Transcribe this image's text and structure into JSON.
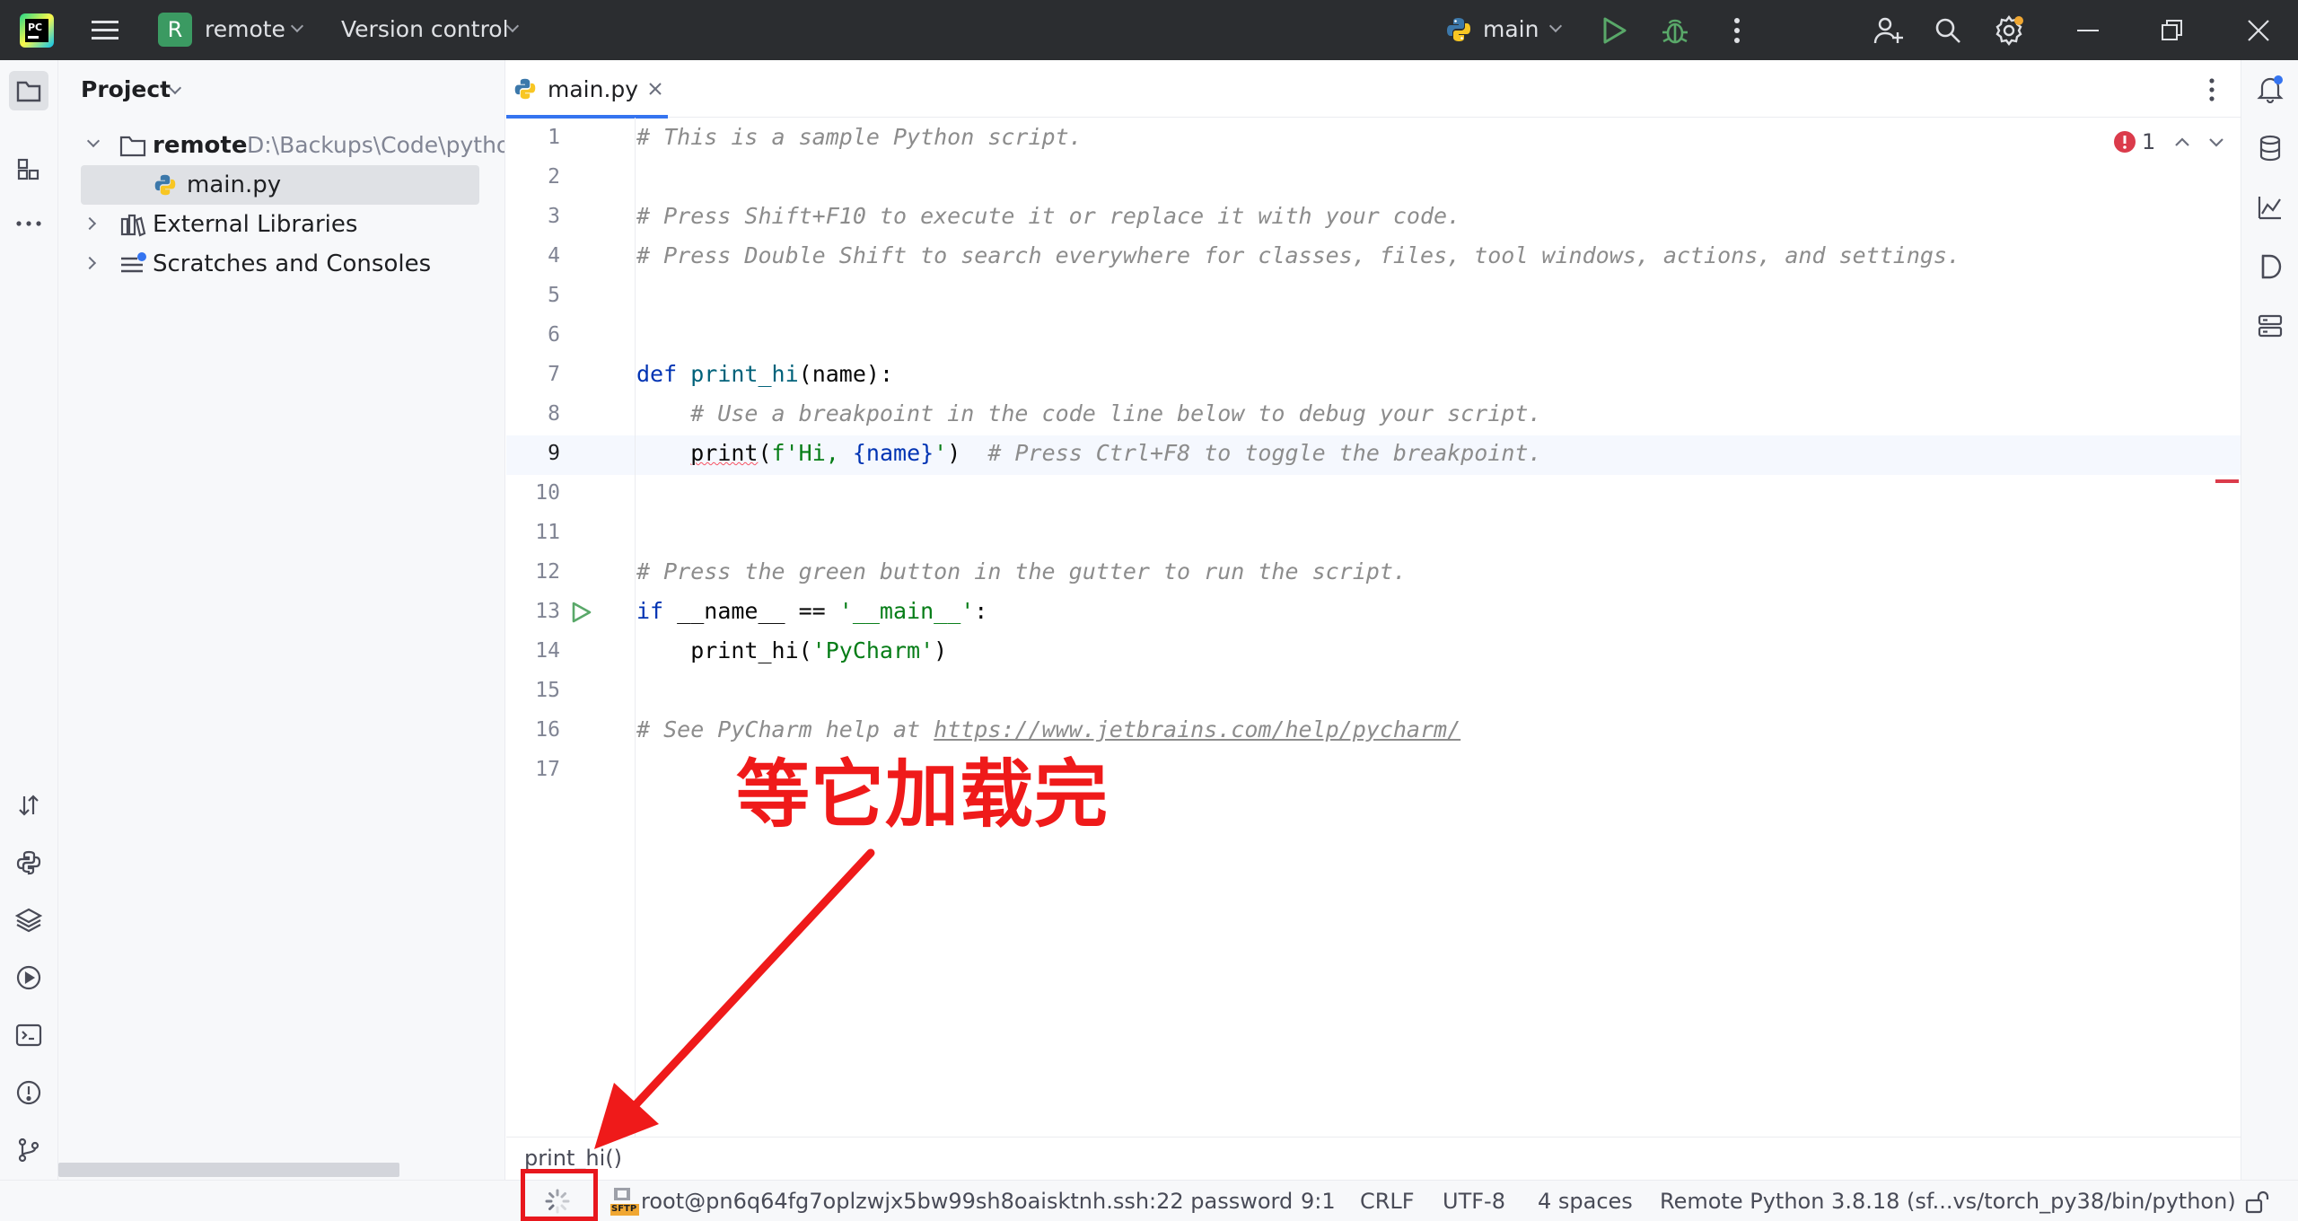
{
  "titlebar": {
    "project_badge": "R",
    "project_name": "remote",
    "vcs_label": "Version control",
    "run_config": "main"
  },
  "project_panel": {
    "title": "Project",
    "tree": [
      {
        "label": "remote",
        "path": "D:\\Backups\\Code\\pytho"
      },
      {
        "label": "main.py"
      },
      {
        "label": "External Libraries"
      },
      {
        "label": "Scratches and Consoles"
      }
    ]
  },
  "editor": {
    "tab_label": "main.py",
    "problems_count": "1",
    "line_numbers": [
      "1",
      "2",
      "3",
      "4",
      "5",
      "6",
      "7",
      "8",
      "9",
      "10",
      "11",
      "12",
      "13",
      "14",
      "15",
      "16",
      "17"
    ],
    "breadcrumb": "print_hi()",
    "code": {
      "l1": "# This is a sample Python script.",
      "l3": "# Press Shift+F10 to execute it or replace it with your code.",
      "l4": "# Press Double Shift to search everywhere for classes, files, tool windows, actions, and settings.",
      "l7_kw": "def",
      "l7_fn": "print_hi",
      "l7_rest": "(name):",
      "l8": "    # Use a breakpoint in the code line below to debug your script.",
      "l9_indent": "    ",
      "l9_fn": "print",
      "l9_open": "(",
      "l9_str1": "f'Hi, ",
      "l9_var": "{name}",
      "l9_str2": "'",
      "l9_close": ")  ",
      "l9_comment": "# Press Ctrl+F8 to toggle the breakpoint.",
      "l12": "# Press the green button in the gutter to run the script.",
      "l13_kw": "if",
      "l13_mid": " __name__ == ",
      "l13_str": "'__main__'",
      "l13_end": ":",
      "l14_pre": "    print_hi(",
      "l14_str": "'PyCharm'",
      "l14_end": ")",
      "l16_pre": "# See PyCharm help at ",
      "l16_link": "https://www.jetbrains.com/help/pycharm/"
    }
  },
  "annotation": {
    "text": "等它加载完"
  },
  "statusbar": {
    "sftp_label": "SFTP",
    "connection": "root@pn6q64fg7oplzwjx5bw99sh8oaisktnh.ssh:22 password",
    "position": "9:1",
    "line_ending": "CRLF",
    "encoding": "UTF-8",
    "indent": "4 spaces",
    "interpreter": "Remote Python 3.8.18 (sf...vs/torch_py38/bin/python)"
  },
  "colors": {
    "accent": "#3574f0",
    "run_green": "#59a869",
    "error_red": "#db3b4b",
    "annotation_red": "#ef1a1a",
    "titlebar_bg": "#2b2d30"
  }
}
